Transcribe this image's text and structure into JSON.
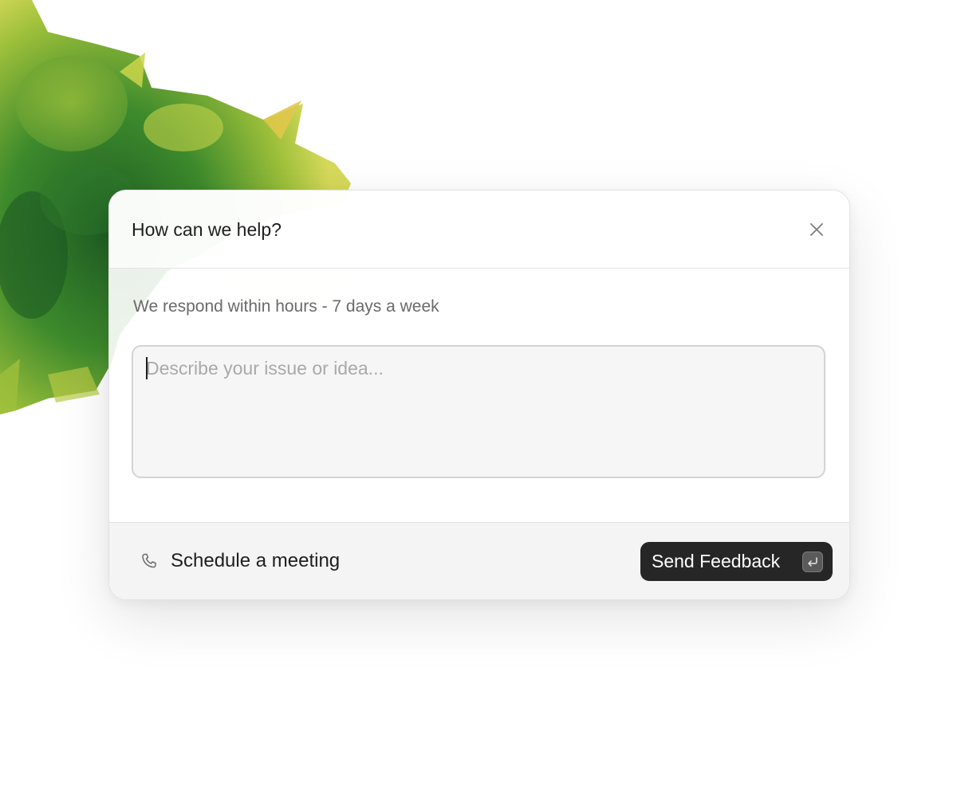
{
  "dialog": {
    "title": "How can we help?",
    "subtitle": "We respond within hours - 7 days a week",
    "close_icon": "close-icon",
    "textarea": {
      "placeholder": "Describe your issue or idea...",
      "value": ""
    },
    "footer": {
      "schedule_label": "Schedule a meeting",
      "schedule_icon": "phone-icon",
      "send_label": "Send Feedback",
      "send_icon": "enter-key-icon"
    }
  },
  "colors": {
    "send_button_bg": "#262626",
    "footer_bg": "#f5f4f4",
    "textarea_bg": "#f7f6f6",
    "foliage_dark": "#2e7a2a",
    "foliage_light": "#c9d84a"
  }
}
